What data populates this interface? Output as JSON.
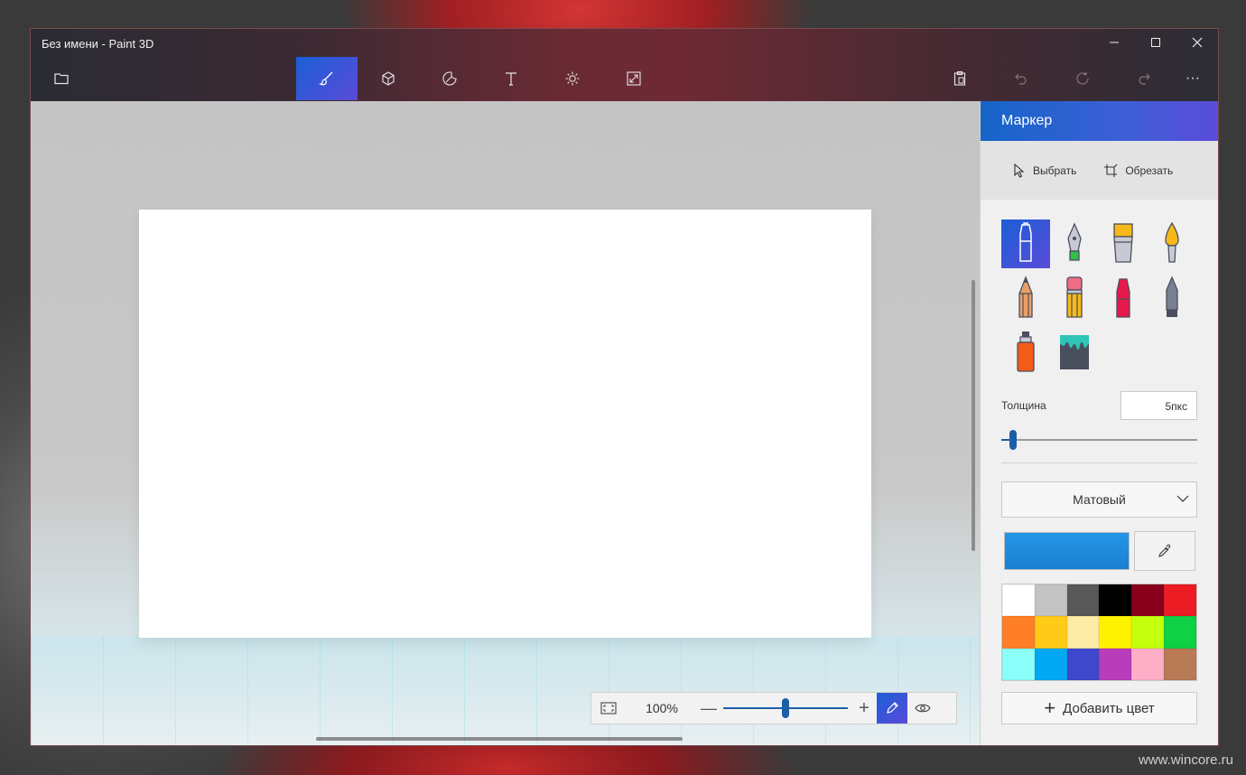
{
  "window": {
    "title": "Без имени - Paint 3D"
  },
  "watermark": "www.wincore.ru",
  "titlebar_controls": {
    "minimize": "—",
    "maximize": "☐",
    "close": "✕"
  },
  "toolbar": {
    "open_icon": "folder-icon",
    "tools": [
      "brushes",
      "3d-shapes",
      "stickers",
      "text",
      "effects",
      "canvas"
    ],
    "right": [
      "paste",
      "undo",
      "history",
      "redo",
      "more"
    ],
    "more_label": "···"
  },
  "zoom": {
    "percent": "100%",
    "minus": "—",
    "plus": "+",
    "level": 0.5
  },
  "panel": {
    "title": "Маркер",
    "select_label": "Выбрать",
    "crop_label": "Обрезать",
    "thickness_label": "Толщина",
    "thickness_value": "5пкс",
    "thickness_level": 0.04,
    "finish": "Матовый",
    "current_color": "#2596e6",
    "add_color_label": "Добавить цвет",
    "palette": [
      "#ffffff",
      "#c3c3c3",
      "#585858",
      "#000000",
      "#88001b",
      "#ec1c24",
      "#ff7f27",
      "#ffca18",
      "#fdeca6",
      "#fff200",
      "#c4ff0e",
      "#0ed145",
      "#8cfffb",
      "#00a8f3",
      "#3f48cc",
      "#b83dba",
      "#ffaec8",
      "#b97a56"
    ]
  },
  "accent_color": "#1b5fd6"
}
